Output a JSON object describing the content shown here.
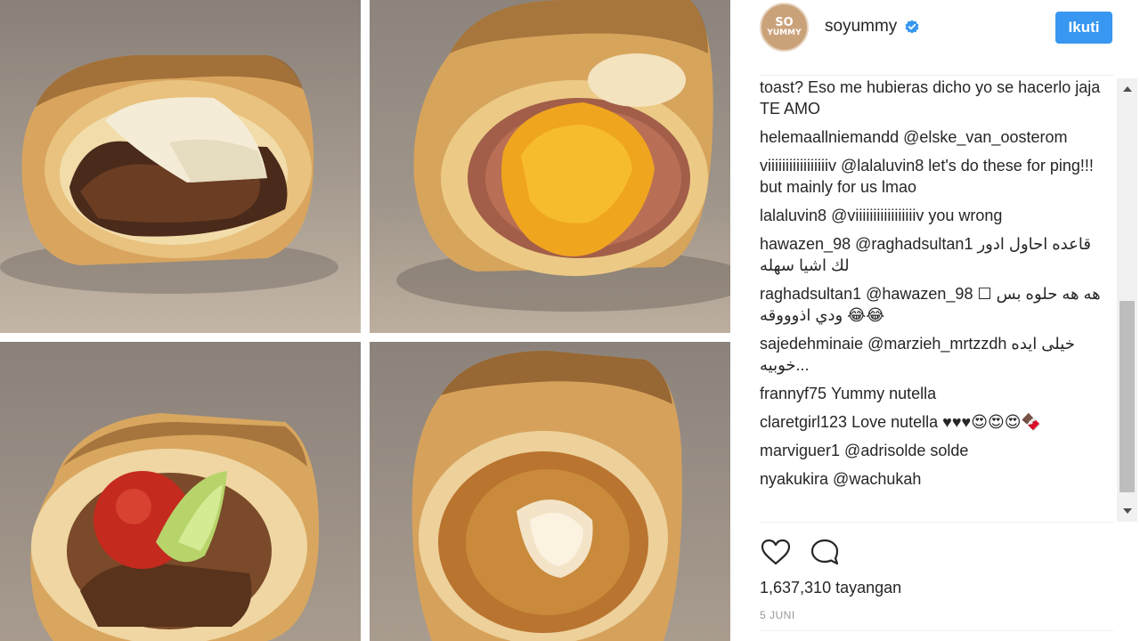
{
  "post": {
    "username": "soyummy",
    "avatar_text_line1": "SO",
    "avatar_text_line2": "YUMMY",
    "follow_label": "Ikuti",
    "views": "1,637,310 tayangan",
    "date": "5 JUNI"
  },
  "comments": [
    {
      "user": "",
      "body": "toast? Eso me hubieras dicho yo se hacerlo jaja TE AMO"
    },
    {
      "user": "helemaallniemandd",
      "body": "@elske_van_oosterom"
    },
    {
      "user": "viiiiiiiiiiiiiiiiiv",
      "body": "@lalaluvin8 let's do these for ping!!! but mainly for us lmao"
    },
    {
      "user": "lalaluvin8",
      "body": "@viiiiiiiiiiiiiiiiiv you wrong"
    },
    {
      "user": "hawazen_98",
      "body": "@raghadsultan1 قاعده احاول ادور لك اشيا سهله"
    },
    {
      "user": "raghadsultan1",
      "body": "@hawazen_98 ☐ هه هه حلوه بس ودي اذوووقه 😂😂"
    },
    {
      "user": "sajedehminaie",
      "body": "@marzieh_mrtzzdh خیلی ایده خوبیه..."
    },
    {
      "user": "frannyf75",
      "body": "Yummy nutella"
    },
    {
      "user": "claretgirl123",
      "body": "Love nutella ♥♥♥😍😍😍🍫"
    },
    {
      "user": "marviguer1",
      "body": "@adrisolde solde"
    },
    {
      "user": "nyakukira",
      "body": "@wachukah"
    }
  ],
  "icons": {
    "verified": "verified-badge-icon",
    "like": "heart-icon",
    "comment": "comment-bubble-icon",
    "scroll_up": "arrow-up-icon",
    "scroll_down": "arrow-down-icon"
  },
  "colors": {
    "follow_button": "#3897f0",
    "verified": "#3897f0",
    "text": "#262626",
    "muted": "#999999"
  }
}
